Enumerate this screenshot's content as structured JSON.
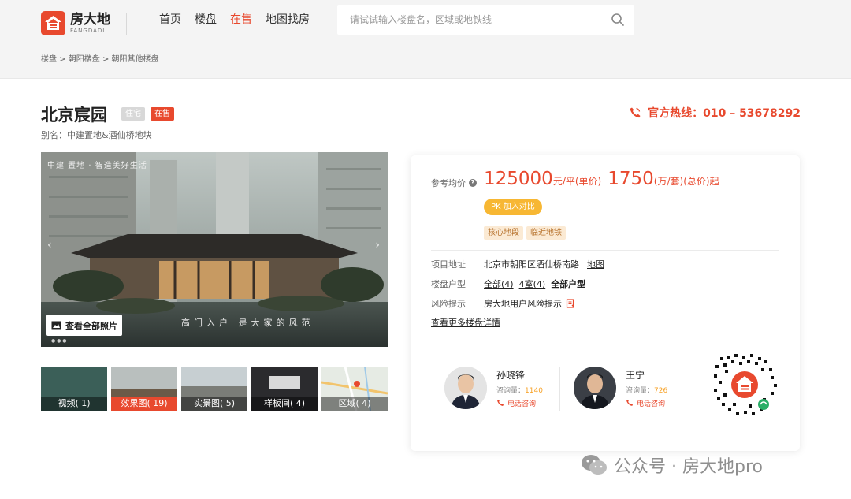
{
  "brand": {
    "name_cn": "房大地",
    "name_en": "FANGDADI"
  },
  "nav": {
    "items": [
      "首页",
      "楼盘",
      "在售",
      "地图找房"
    ],
    "active_index": 2
  },
  "search": {
    "placeholder": "请试试输入楼盘名，区域或地铁线"
  },
  "breadcrumb": {
    "items": [
      "楼盘",
      "朝阳楼盘",
      "朝阳其他楼盘"
    ],
    "separator": ">"
  },
  "project": {
    "title": "北京宸园",
    "tag_type": "住宅",
    "tag_status": "在售",
    "alias": "别名：中建置地&酒仙桥地块"
  },
  "hotline": {
    "text": "官方热线：010 – 53678292"
  },
  "gallery": {
    "brand_overlay": "中建 置地 · 智造美好生活",
    "slogan": "高门入户  是大家的风范",
    "view_all_label": "查看全部照片",
    "thumbs": [
      {
        "label": "视频( 1)",
        "active": false
      },
      {
        "label": "效果图( 19)",
        "active": true
      },
      {
        "label": "实景图( 5)",
        "active": false
      },
      {
        "label": "样板间( 4)",
        "active": false
      },
      {
        "label": "区域( 4)",
        "active": false
      }
    ]
  },
  "price": {
    "label": "参考均价",
    "unit_price": "125000",
    "unit_price_suffix": "元/平(单价)",
    "total_price": "1750",
    "total_price_suffix": "(万/套)(总价)起",
    "pk_label": "PK  加入对比",
    "tags": [
      "核心地段",
      "临近地铁"
    ]
  },
  "details": {
    "address_label": "项目地址",
    "address_value": "北京市朝阳区酒仙桥南路",
    "map_link": "地图",
    "layout_label": "楼盘户型",
    "layout_all": "全部(4)",
    "layout_4room": "4室(4)",
    "layout_all_types": "全部户型",
    "risk_label": "风险提示",
    "risk_value": "房大地用户风险提示",
    "more_link": "查看更多楼盘详情"
  },
  "agents": [
    {
      "name": "孙晓锋",
      "count_label": "咨询量：",
      "count": "1140",
      "call_label": "电话咨询"
    },
    {
      "name": "王宁",
      "count_label": "咨询量：",
      "count": "726",
      "call_label": "电话咨询"
    }
  ],
  "watermark": {
    "text": "公众号 · 房大地pro"
  },
  "colors": {
    "accent": "#e8492e",
    "pk": "#f7b733",
    "tag_bg": "#fbead4"
  }
}
